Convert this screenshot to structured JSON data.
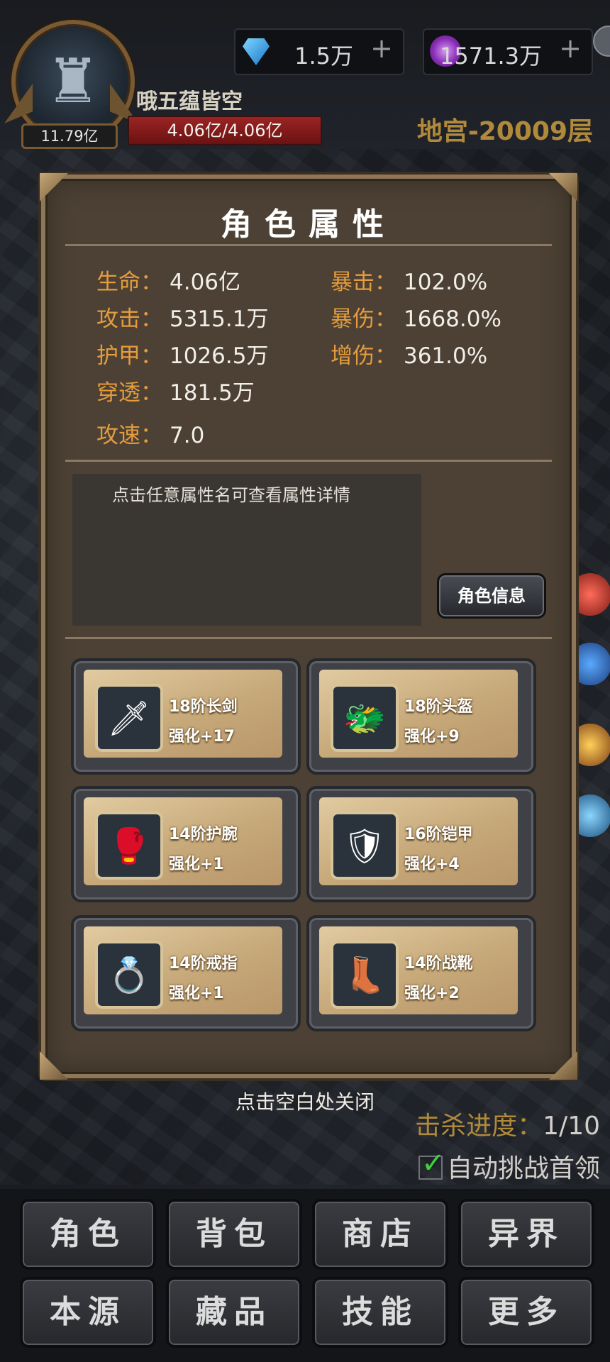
{
  "player": {
    "power": "11.79亿",
    "name": "哦五蕴皆空",
    "hp": "4.06亿/4.06亿"
  },
  "resources": {
    "diamond": "1.5万",
    "orb": "1571.3万",
    "plus": "+"
  },
  "floor": "地宫-20009层",
  "panel": {
    "title": "角色属性",
    "stats_left": [
      {
        "k": "生命：",
        "v": "4.06亿"
      },
      {
        "k": "攻击：",
        "v": "5315.1万"
      },
      {
        "k": "护甲：",
        "v": "1026.5万"
      },
      {
        "k": "穿透：",
        "v": "181.5万"
      },
      {
        "k": "攻速：",
        "v": "7.0"
      }
    ],
    "stats_right": [
      {
        "k": "暴击：",
        "v": "102.0%"
      },
      {
        "k": "暴伤：",
        "v": "1668.0%"
      },
      {
        "k": "增伤：",
        "v": "361.0%"
      }
    ],
    "hint": "点击任意属性名可查看属性详情",
    "role_info_button": "角色信息",
    "equipment": [
      {
        "name": "18阶长剑",
        "level": "强化+17",
        "icon": "sword-icon",
        "glyph": "🗡"
      },
      {
        "name": "18阶头盔",
        "level": "强化+9",
        "icon": "helmet-icon",
        "glyph": "🐲"
      },
      {
        "name": "14阶护腕",
        "level": "强化+1",
        "icon": "bracer-icon",
        "glyph": "🥊"
      },
      {
        "name": "16阶铠甲",
        "level": "强化+4",
        "icon": "armor-icon",
        "glyph": "🛡"
      },
      {
        "name": "14阶戒指",
        "level": "强化+1",
        "icon": "ring-icon",
        "glyph": "💍"
      },
      {
        "name": "14阶战靴",
        "level": "强化+2",
        "icon": "boots-icon",
        "glyph": "👢"
      }
    ]
  },
  "close_hint": "点击空白处关闭",
  "kill_progress": {
    "label": "击杀进度：",
    "value": "1/10"
  },
  "auto_challenge": "自动挑战首领",
  "menu": [
    "角色",
    "背包",
    "商店",
    "异界",
    "本源",
    "藏品",
    "技能",
    "更多"
  ]
}
